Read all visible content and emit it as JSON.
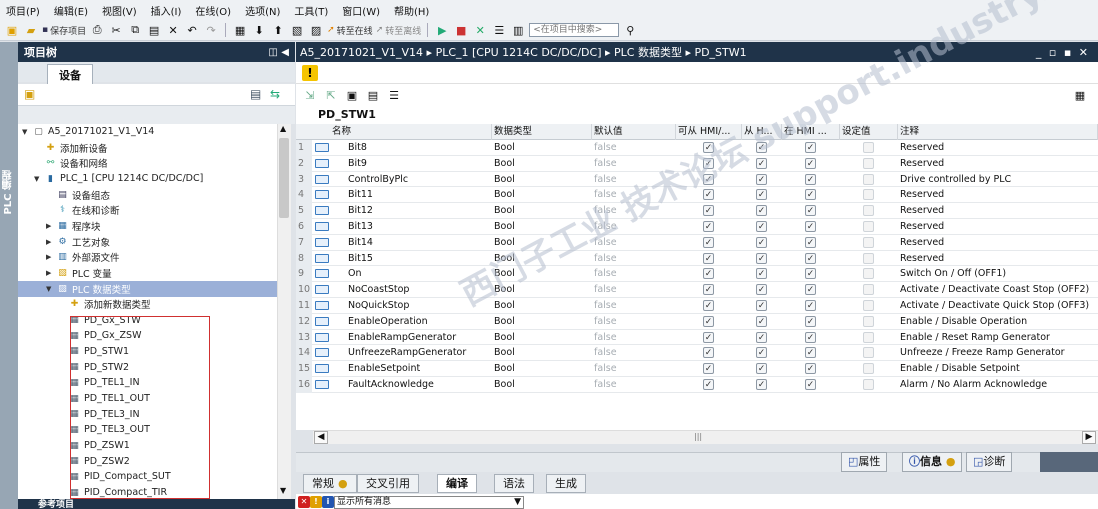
{
  "menu": [
    "项目(P)",
    "编辑(E)",
    "视图(V)",
    "插入(I)",
    "在线(O)",
    "选项(N)",
    "工具(T)",
    "窗口(W)",
    "帮助(H)"
  ],
  "toolbar": {
    "save_project": "保存项目",
    "go_online": "转至在线",
    "go_offline": "转至离线",
    "search_placeholder": "<在项目中搜索>"
  },
  "left_strip_label": "PLC 编程",
  "project_tree": {
    "title": "项目树",
    "devices_tab": "设备",
    "items": [
      {
        "label": "A5_20171021_V1_V14",
        "indent": 0,
        "arrow": "▼",
        "icon": "project-icon"
      },
      {
        "label": "添加新设备",
        "indent": 1,
        "arrow": "",
        "icon": "add-device-icon"
      },
      {
        "label": "设备和网络",
        "indent": 1,
        "arrow": "",
        "icon": "network-icon"
      },
      {
        "label": "PLC_1 [CPU 1214C DC/DC/DC]",
        "indent": 1,
        "arrow": "▼",
        "icon": "plc-icon"
      },
      {
        "label": "设备组态",
        "indent": 2,
        "arrow": "",
        "icon": "device-config-icon"
      },
      {
        "label": "在线和诊断",
        "indent": 2,
        "arrow": "",
        "icon": "diagnostics-icon"
      },
      {
        "label": "程序块",
        "indent": 2,
        "arrow": "▶",
        "icon": "program-blocks-icon"
      },
      {
        "label": "工艺对象",
        "indent": 2,
        "arrow": "▶",
        "icon": "tech-objects-icon"
      },
      {
        "label": "外部源文件",
        "indent": 2,
        "arrow": "▶",
        "icon": "ext-source-icon"
      },
      {
        "label": "PLC 变量",
        "indent": 2,
        "arrow": "▶",
        "icon": "plc-tags-icon"
      },
      {
        "label": "PLC 数据类型",
        "indent": 2,
        "arrow": "▼",
        "icon": "plc-datatype-icon",
        "selected": true
      },
      {
        "label": "添加新数据类型",
        "indent": 3,
        "arrow": "",
        "icon": "add-datatype-icon"
      },
      {
        "label": "PD_Gx_STW",
        "indent": 3,
        "arrow": "",
        "icon": "udt-icon"
      },
      {
        "label": "PD_Gx_ZSW",
        "indent": 3,
        "arrow": "",
        "icon": "udt-icon"
      },
      {
        "label": "PD_STW1",
        "indent": 3,
        "arrow": "",
        "icon": "udt-icon"
      },
      {
        "label": "PD_STW2",
        "indent": 3,
        "arrow": "",
        "icon": "udt-icon"
      },
      {
        "label": "PD_TEL1_IN",
        "indent": 3,
        "arrow": "",
        "icon": "udt-icon"
      },
      {
        "label": "PD_TEL1_OUT",
        "indent": 3,
        "arrow": "",
        "icon": "udt-icon"
      },
      {
        "label": "PD_TEL3_IN",
        "indent": 3,
        "arrow": "",
        "icon": "udt-icon"
      },
      {
        "label": "PD_TEL3_OUT",
        "indent": 3,
        "arrow": "",
        "icon": "udt-icon"
      },
      {
        "label": "PD_ZSW1",
        "indent": 3,
        "arrow": "",
        "icon": "udt-icon"
      },
      {
        "label": "PD_ZSW2",
        "indent": 3,
        "arrow": "",
        "icon": "udt-icon"
      },
      {
        "label": "PID_Compact_SUT",
        "indent": 3,
        "arrow": "",
        "icon": "udt-icon"
      },
      {
        "label": "PID_Compact_TIR",
        "indent": 3,
        "arrow": "",
        "icon": "udt-icon"
      }
    ],
    "reference_header": "参考项目"
  },
  "breadcrumb": "A5_20171021_V1_V14 ▸ PLC_1 [CPU 1214C DC/DC/DC] ▸ PLC 数据类型 ▸ PD_STW1",
  "datatype_name": "PD_STW1",
  "columns": [
    "名称",
    "数据类型",
    "默认值",
    "可从 HMI/...",
    "从 H...",
    "在 HMI ...",
    "设定值",
    "注释"
  ],
  "rows": [
    {
      "num": "1",
      "name": "Bit8",
      "type": "Bool",
      "default": "false",
      "comment": "Reserved"
    },
    {
      "num": "2",
      "name": "Bit9",
      "type": "Bool",
      "default": "false",
      "comment": "Reserved"
    },
    {
      "num": "3",
      "name": "ControlByPlc",
      "type": "Bool",
      "default": "false",
      "comment": "Drive controlled by PLC"
    },
    {
      "num": "4",
      "name": "Bit11",
      "type": "Bool",
      "default": "false",
      "comment": "Reserved"
    },
    {
      "num": "5",
      "name": "Bit12",
      "type": "Bool",
      "default": "false",
      "comment": "Reserved"
    },
    {
      "num": "6",
      "name": "Bit13",
      "type": "Bool",
      "default": "false",
      "comment": "Reserved"
    },
    {
      "num": "7",
      "name": "Bit14",
      "type": "Bool",
      "default": "false",
      "comment": "Reserved"
    },
    {
      "num": "8",
      "name": "Bit15",
      "type": "Bool",
      "default": "false",
      "comment": "Reserved"
    },
    {
      "num": "9",
      "name": "On",
      "type": "Bool",
      "default": "false",
      "comment": "Switch On / Off (OFF1)"
    },
    {
      "num": "10",
      "name": "NoCoastStop",
      "type": "Bool",
      "default": "false",
      "comment": "Activate / Deactivate Coast Stop (OFF2)"
    },
    {
      "num": "11",
      "name": "NoQuickStop",
      "type": "Bool",
      "default": "false",
      "comment": "Activate / Deactivate Quick Stop (OFF3)"
    },
    {
      "num": "12",
      "name": "EnableOperation",
      "type": "Bool",
      "default": "false",
      "comment": "Enable / Disable Operation"
    },
    {
      "num": "13",
      "name": "EnableRampGenerator",
      "type": "Bool",
      "default": "false",
      "comment": "Enable / Reset Ramp Generator"
    },
    {
      "num": "14",
      "name": "UnfreezeRampGenerator",
      "type": "Bool",
      "default": "false",
      "comment": "Unfreeze / Freeze Ramp Generator"
    },
    {
      "num": "15",
      "name": "EnableSetpoint",
      "type": "Bool",
      "default": "false",
      "comment": "Enable / Disable Setpoint"
    },
    {
      "num": "16",
      "name": "FaultAcknowledge",
      "type": "Bool",
      "default": "false",
      "comment": "Alarm / No Alarm Acknowledge"
    }
  ],
  "inspector": {
    "properties": "属性",
    "info": "信息",
    "diagnostics": "诊断"
  },
  "bottom_tabs": [
    "常规",
    "交叉引用",
    "编译",
    "语法",
    "生成"
  ],
  "filter_text": "显示所有消息",
  "watermark": "西门子工业 技术论坛 support.industry.siemens.com"
}
